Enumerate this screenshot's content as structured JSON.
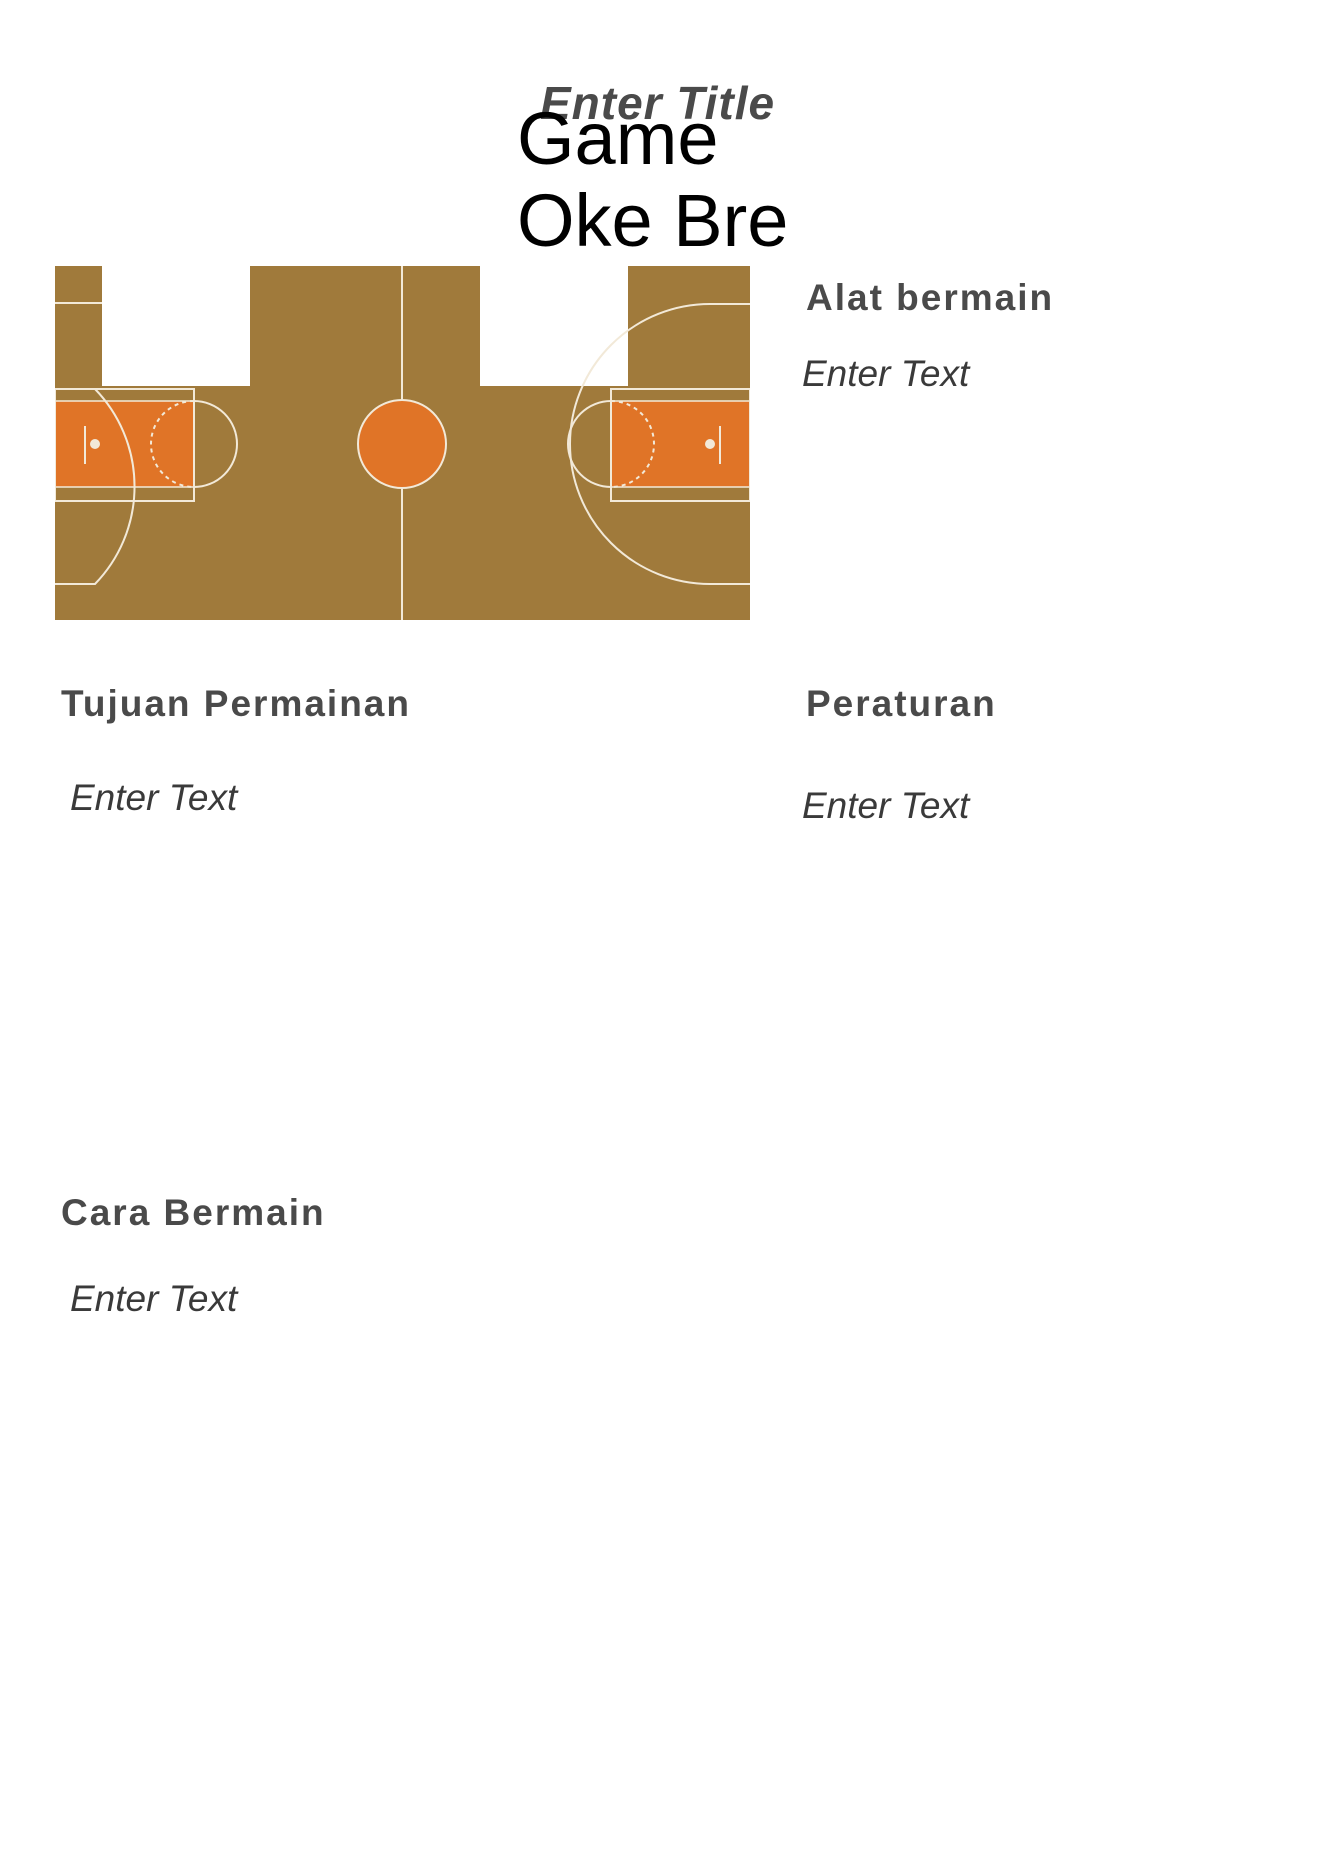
{
  "title": {
    "placeholder": "Enter Title",
    "text": "Game Oke Bre"
  },
  "sections": [
    {
      "heading": "Alat bermain",
      "text": "Enter Text"
    },
    {
      "heading": "Tujuan Permainan",
      "text": "Enter Text"
    },
    {
      "heading": "Peraturan",
      "text": "Enter Text"
    },
    {
      "heading": "Cara Bermain",
      "text": "Enter Text"
    }
  ],
  "colors": {
    "court": "#a07a3b",
    "key": "#e07427",
    "lines": "#f2e9d8",
    "heading": "#4a4a4a"
  },
  "image": {
    "icon": "basketball-court-image"
  }
}
